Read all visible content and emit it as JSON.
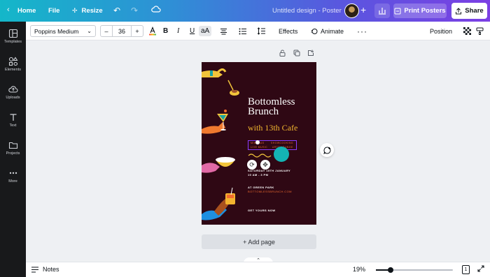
{
  "topbar": {
    "home_label": "Home",
    "file_label": "File",
    "resize_label": "Resize",
    "doc_title": "Untitled design - Poster",
    "print_label": "Print Posters",
    "share_label": "Share"
  },
  "sidebar": {
    "items": [
      {
        "label": "Templates",
        "icon": "templates-icon"
      },
      {
        "label": "Elements",
        "icon": "elements-icon"
      },
      {
        "label": "Uploads",
        "icon": "uploads-icon"
      },
      {
        "label": "Text",
        "icon": "text-icon"
      },
      {
        "label": "Projects",
        "icon": "folder-icon"
      },
      {
        "label": "More",
        "icon": "more-icon"
      }
    ]
  },
  "toolbar": {
    "font_family": "Poppins Medium",
    "font_size": "36",
    "effects_label": "Effects",
    "animate_label": "Animate",
    "position_label": "Position"
  },
  "poster": {
    "title_line1": "Bottomless",
    "title_line2": "Brunch",
    "subtitle": "with 13th Cafe",
    "tag1": "MIMOSAS",
    "tag2": "SHOWCOOKING",
    "tag3": "LIVE MUSIC",
    "tag4": "ARTS LOUNGE",
    "date": "SATURDAY 15TH JANUARY",
    "time": "10 AM - 3 PM",
    "venue": "AT GREEN PARK",
    "website": "BOTTOMLESSBRUNCH.COM",
    "cta": "GET YOURS NOW",
    "bg_color": "#2f0814",
    "title_color": "#ffffff",
    "subtitle_color": "#f0b52f"
  },
  "canvas": {
    "add_page_label": "+ Add page"
  },
  "bottombar": {
    "notes_label": "Notes",
    "zoom_label": "19%",
    "zoom_level": 0.19,
    "page_count": "1"
  },
  "colors": {
    "gradient_start": "#14b7c9",
    "gradient_end": "#7b3fe4",
    "sidebar_bg": "#18191b"
  }
}
